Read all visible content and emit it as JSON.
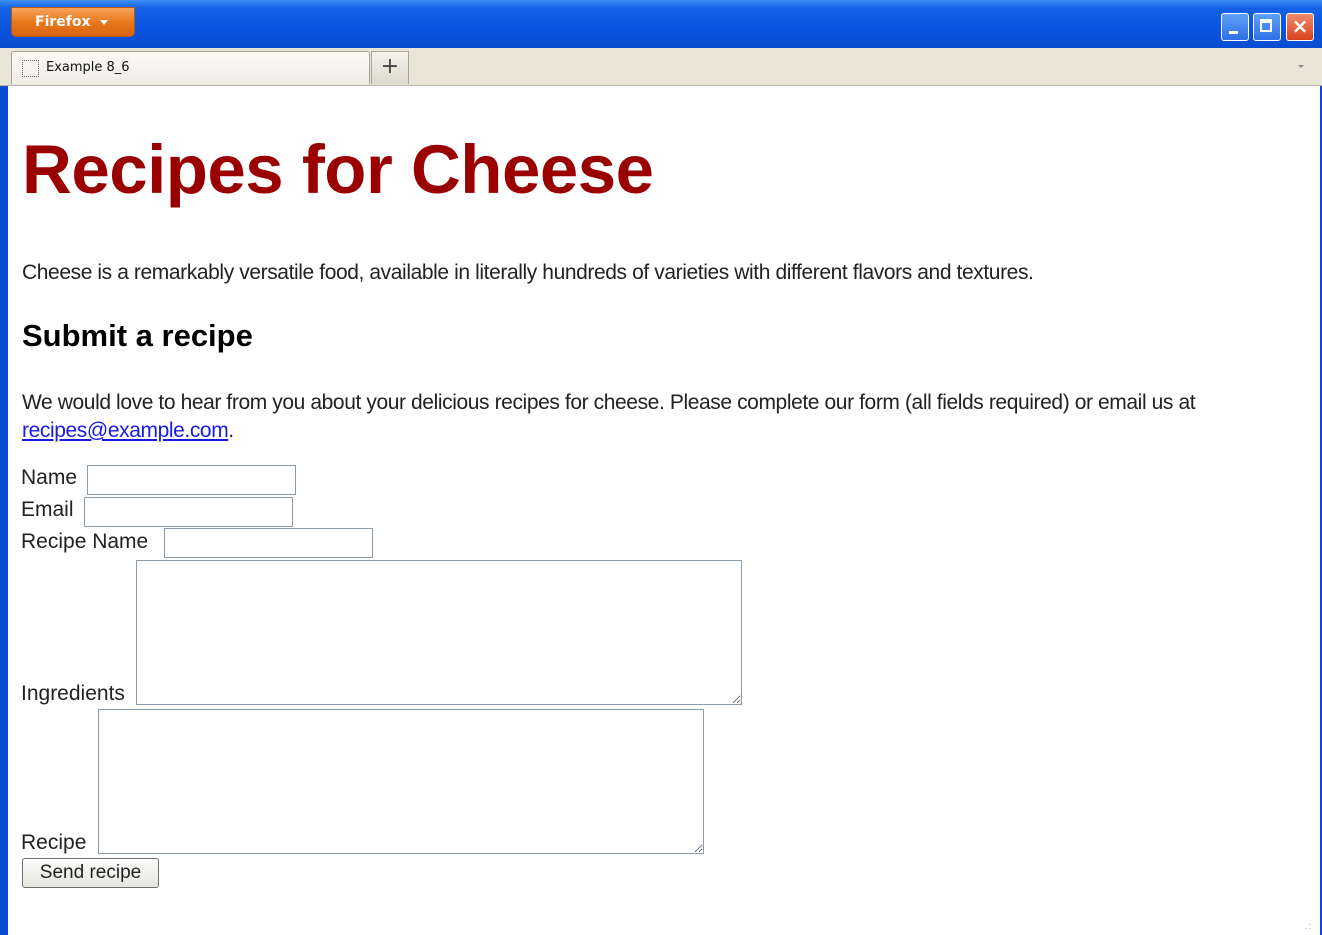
{
  "window": {
    "app_menu_label": "Firefox"
  },
  "tabs": [
    {
      "label": "Example 8_6"
    }
  ],
  "new_tab_label": "+",
  "page": {
    "title": "Recipes for Cheese",
    "intro": "Cheese is a remarkably versatile food, available in literally hundreds of varieties with different flavors and textures.",
    "section_heading": "Submit a recipe",
    "paragraph_before_link": "We would love to hear from you about your delicious recipes for cheese. Please complete our form (all fields required) or email us at ",
    "email_link": "recipes@example.com",
    "paragraph_after_link": "."
  },
  "form": {
    "name_label": "Name",
    "name_value": "",
    "email_label": "Email",
    "email_value": "",
    "recipe_name_label": "Recipe Name",
    "recipe_name_value": "",
    "ingredients_label": "Ingredients",
    "ingredients_value": "",
    "recipe_label": "Recipe",
    "recipe_value": "",
    "submit_label": "Send recipe"
  },
  "colors": {
    "heading": "#9b0000",
    "link": "#1a1ae6",
    "titlebar": "#0a54df",
    "app_button": "#e8791e"
  }
}
